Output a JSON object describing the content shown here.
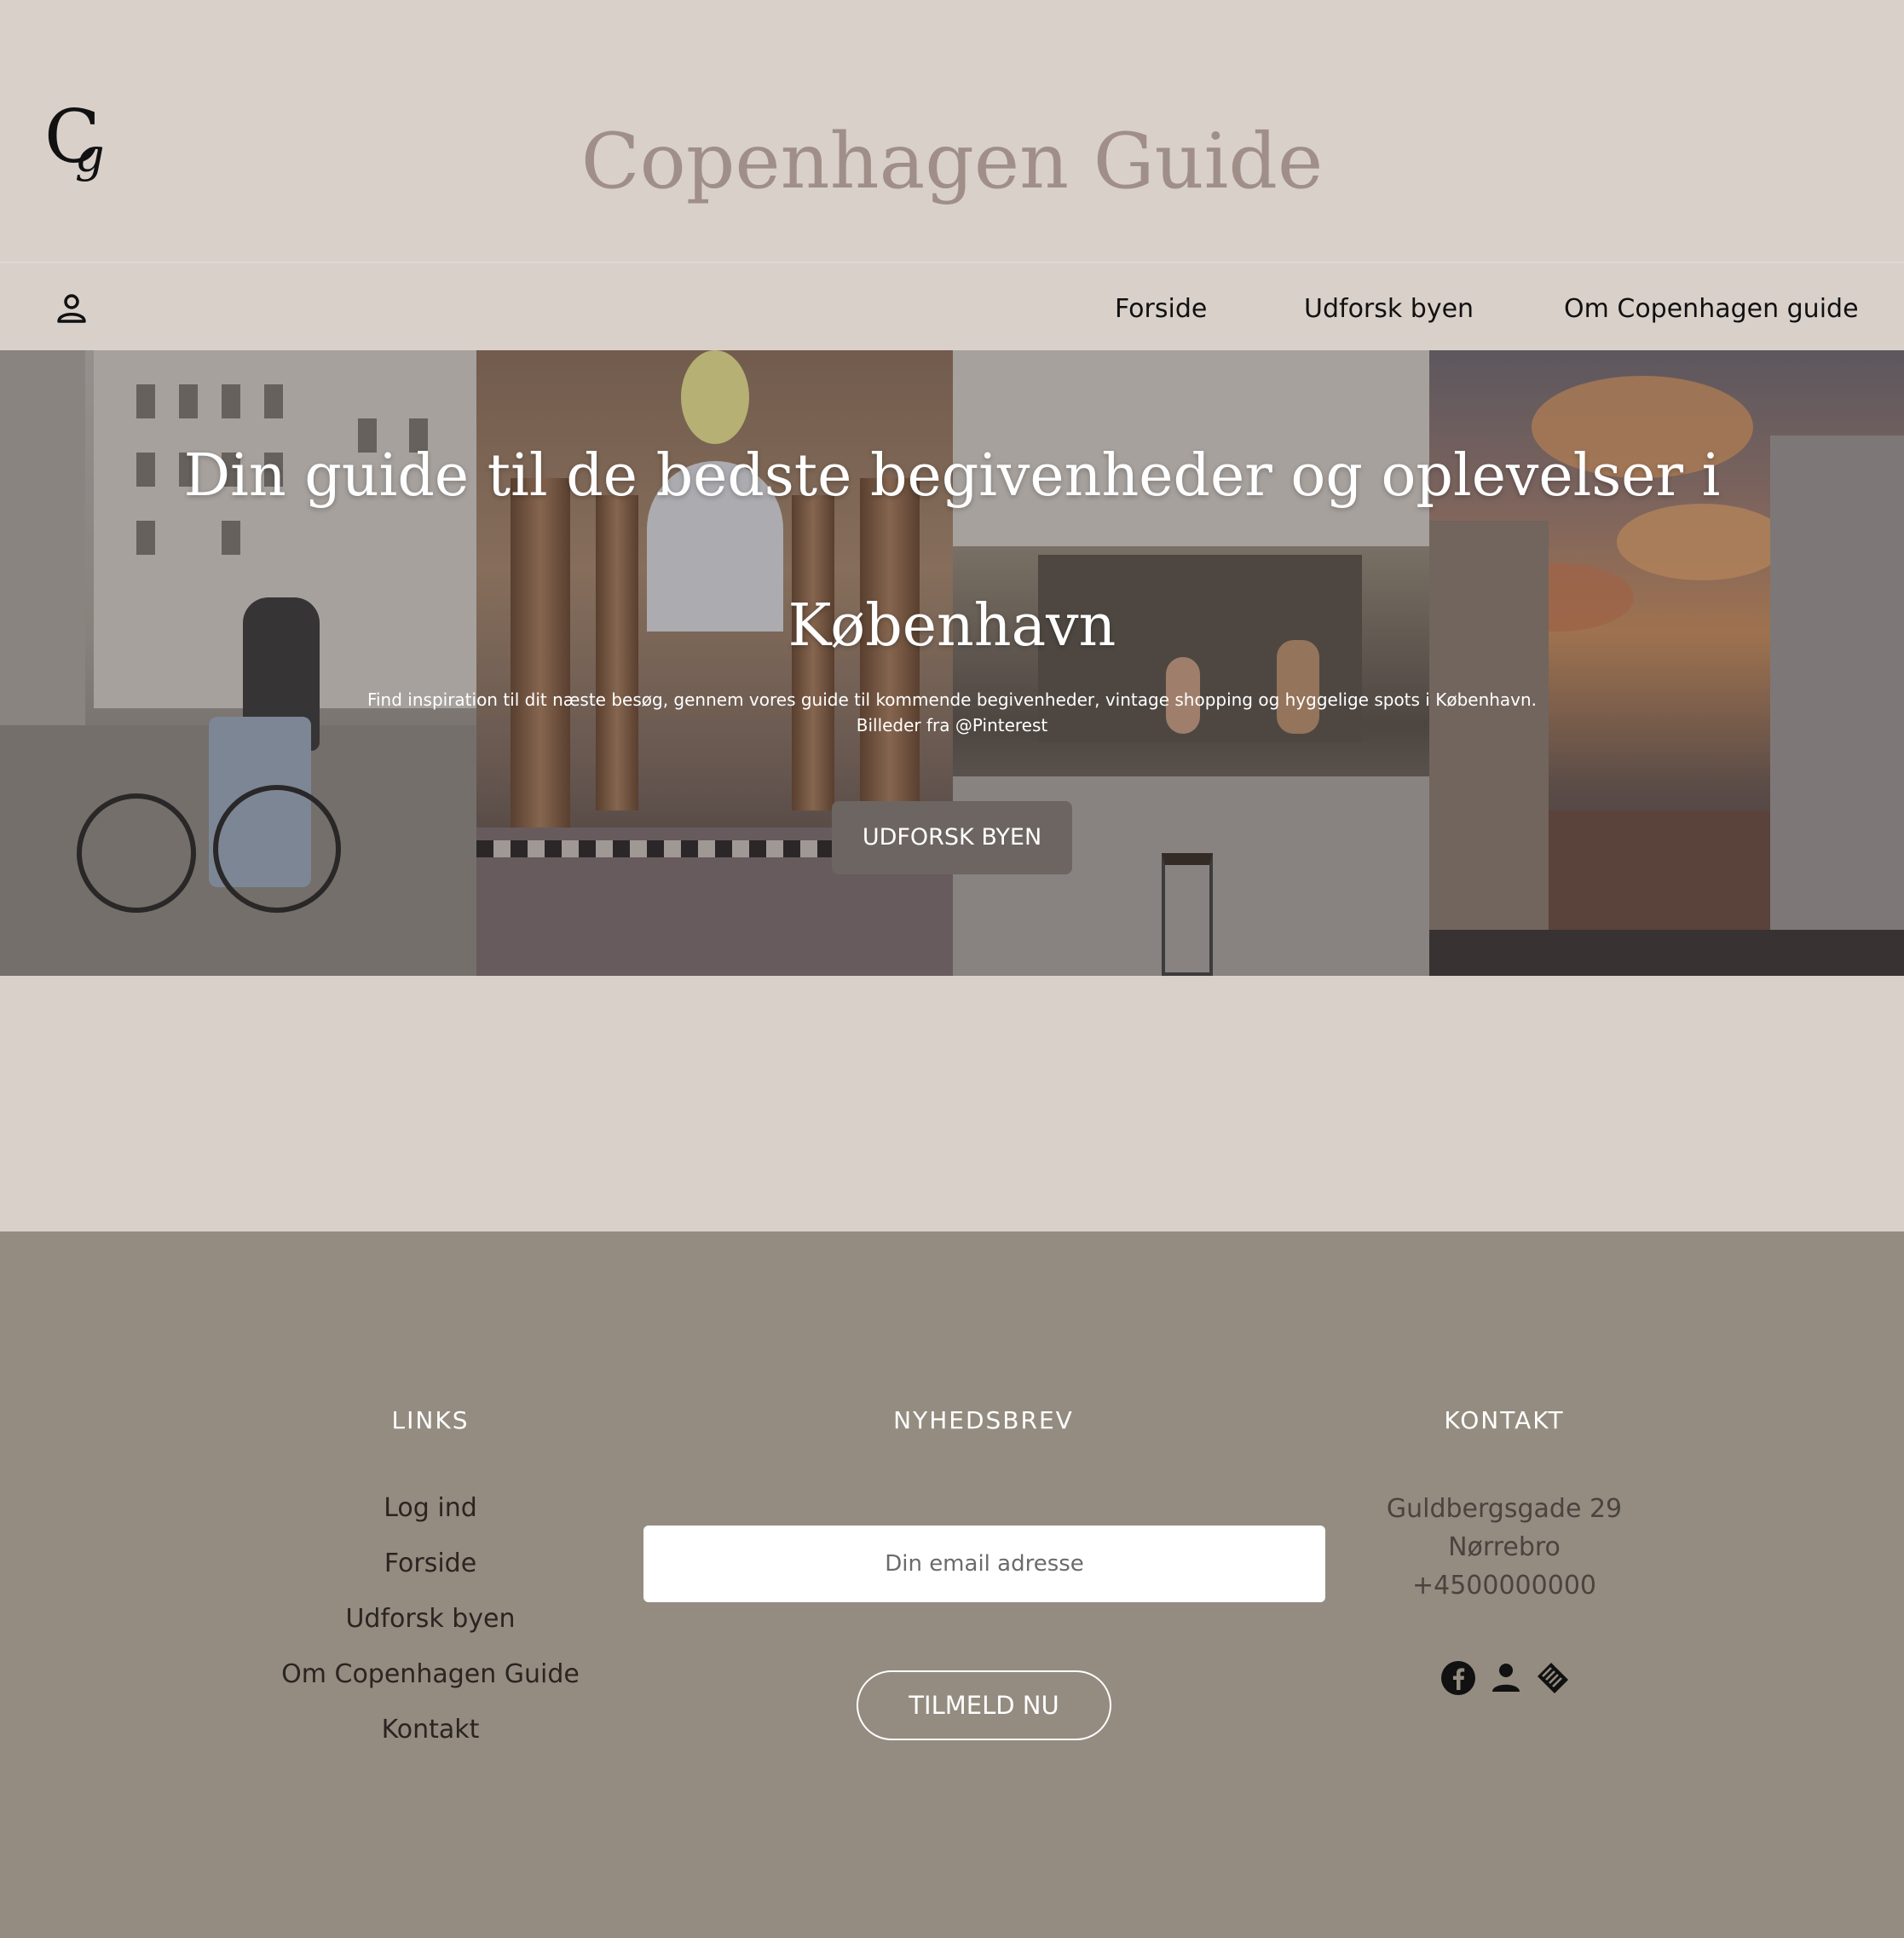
{
  "header": {
    "logo": {
      "c": "C",
      "g": "g"
    },
    "title": "Copenhagen Guide"
  },
  "nav": {
    "items": [
      "Forside",
      "Udforsk byen",
      "Om Copenhagen guide"
    ]
  },
  "hero": {
    "title": "Din guide til de bedste begivenheder og oplevelser i København",
    "text_line1": "Find inspiration til dit næste besøg, gennem vores guide til kommende begivenheder, vintage shopping og hyggelige spots i København.",
    "text_line2": "Billeder fra @Pinterest",
    "button": "UDFORSK BYEN"
  },
  "footer": {
    "links_heading": "LINKS",
    "links": [
      "Log ind",
      "Forside",
      "Udforsk byen",
      "Om Copenhagen Guide",
      "Kontakt"
    ],
    "newsletter_heading": "NYHEDSBREV",
    "email_placeholder": "Din email adresse",
    "subscribe_button": "TILMELD NU",
    "contact_heading": "KONTAKT",
    "contact": [
      "Guldbergsgade 29",
      "Nørrebro",
      "+4500000000"
    ],
    "social_icons": [
      "facebook-icon",
      "user-icon",
      "tag-icon"
    ]
  },
  "colors": {
    "page_bg": "#d9d0ca",
    "title": "#a08f89",
    "footer_bg": "#948c80",
    "hero_button": "#6d6561"
  }
}
